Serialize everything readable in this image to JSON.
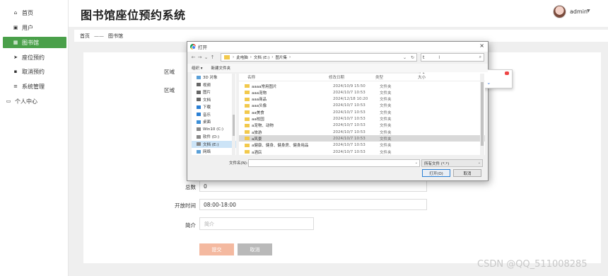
{
  "sidebar": {
    "items": [
      {
        "label": "首页",
        "icon": "home-icon"
      },
      {
        "label": "用户",
        "icon": "user-icon"
      },
      {
        "label": "图书馆",
        "icon": "grid-icon"
      },
      {
        "label": "座位预约",
        "icon": "send-icon"
      },
      {
        "label": "取消预约",
        "icon": "cancel-icon"
      },
      {
        "label": "系统管理",
        "icon": "list-icon"
      },
      {
        "label": "个人中心",
        "icon": "profile-icon"
      }
    ],
    "active_color": "#4aa04a"
  },
  "header": {
    "title": "图书馆座位预约系统",
    "user": "admin"
  },
  "breadcrumb": {
    "home": "首页",
    "separator": "——",
    "current": "图书馆"
  },
  "form": {
    "labels": {
      "area1": "区域",
      "area2": "区域",
      "total": "总数",
      "open_time": "开放时间",
      "intro": "简介"
    },
    "values": {
      "total": "0",
      "open_time": "08:00-18:00"
    },
    "intro_placeholder": "简介",
    "submit": "提交",
    "cancel": "取消",
    "submit_color": "#f4b9a0",
    "cancel_color": "#b9b9b9"
  },
  "dialog": {
    "title": "打开",
    "close": "×",
    "address": [
      "此电脑",
      "文档 (E:)",
      "图片集"
    ],
    "search_text": "t",
    "ime": {
      "input": "t",
      "candidates": [
        "1他",
        "2她",
        "3通",
        "4天",
        "5吐"
      ],
      "more": "› ⌄"
    },
    "toolbar": [
      "组织 ▾",
      "新建文件夹"
    ],
    "nav_items": [
      {
        "label": "3D 对象",
        "color": "#5aa0d8"
      },
      {
        "label": "视频",
        "color": "#666"
      },
      {
        "label": "图片",
        "color": "#666"
      },
      {
        "label": "文档",
        "color": "#666"
      },
      {
        "label": "下载",
        "color": "#2a7fd4"
      },
      {
        "label": "音乐",
        "color": "#2a7fd4"
      },
      {
        "label": "桌面",
        "color": "#3b8fd8"
      },
      {
        "label": "Win10 (C:)",
        "color": "#888"
      },
      {
        "label": "软件 (D:)",
        "color": "#888"
      },
      {
        "label": "文档 (E:)",
        "color": "#888"
      },
      {
        "label": "网络",
        "color": "#5aa0d8"
      }
    ],
    "columns": [
      "名称",
      "修改日期",
      "类型",
      "大小"
    ],
    "files": [
      {
        "name": "aaaa常用图片",
        "date": "2024/10/9 15:50",
        "type": "文件夹"
      },
      {
        "name": "aaa宠物",
        "date": "2024/10/7 10:53",
        "type": "文件夹"
      },
      {
        "name": "aaa商品",
        "date": "2024/12/18 10:20",
        "type": "文件夹"
      },
      {
        "name": "aaa头像",
        "date": "2024/10/7 10:53",
        "type": "文件夹"
      },
      {
        "name": "aa美食",
        "date": "2024/10/7 10:53",
        "type": "文件夹"
      },
      {
        "name": "aa校园",
        "date": "2024/10/7 10:53",
        "type": "文件夹"
      },
      {
        "name": "a宠物、动物",
        "date": "2024/10/7 10:53",
        "type": "文件夹"
      },
      {
        "name": "a旅游",
        "date": "2024/10/7 10:53",
        "type": "文件夹"
      },
      {
        "name": "a风景",
        "date": "2024/10/7 10:53",
        "type": "文件夹"
      },
      {
        "name": "a健康、健身、健身房、健身用品",
        "date": "2024/10/7 10:53",
        "type": "文件夹"
      },
      {
        "name": "a酒店",
        "date": "2024/10/7 10:53",
        "type": "文件夹"
      }
    ],
    "filename_label": "文件名(N):",
    "filetype": "所有文件 (*.*)",
    "open": "打开(O)",
    "cancel": "取消"
  },
  "watermark": "CSDN @QQ_511008285"
}
